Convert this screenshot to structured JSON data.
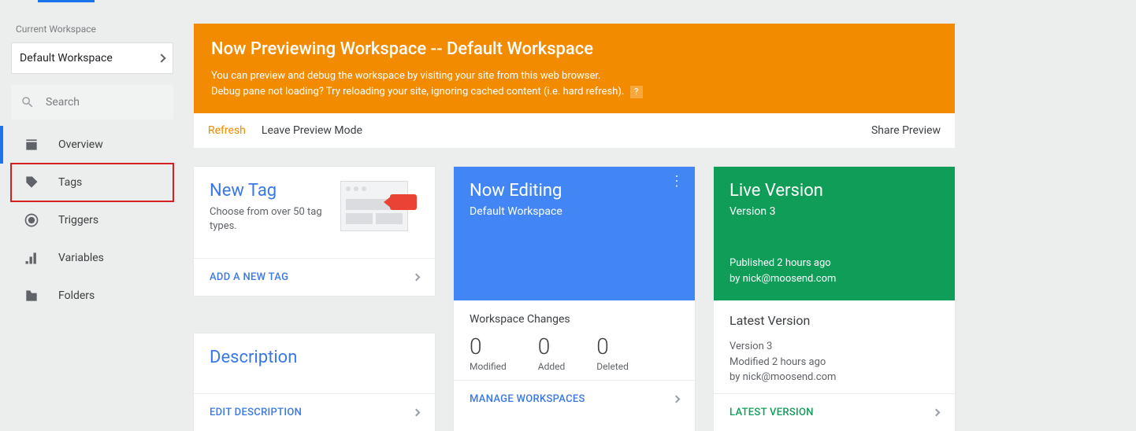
{
  "sidebar": {
    "current_workspace_label": "Current Workspace",
    "workspace_name": "Default Workspace",
    "search_placeholder": "Search",
    "items": [
      {
        "label": "Overview"
      },
      {
        "label": "Tags"
      },
      {
        "label": "Triggers"
      },
      {
        "label": "Variables"
      },
      {
        "label": "Folders"
      }
    ]
  },
  "preview": {
    "title": "Now Previewing Workspace -- Default Workspace",
    "line1": "You can preview and debug the workspace by visiting your site from this web browser.",
    "line2": "Debug pane not loading? Try reloading your site, ignoring cached content (i.e. hard refresh).",
    "refresh": "Refresh",
    "leave": "Leave Preview Mode",
    "share": "Share Preview",
    "help": "?"
  },
  "newtag": {
    "title": "New Tag",
    "subtitle": "Choose from over 50 tag types.",
    "action": "ADD A NEW TAG"
  },
  "description": {
    "title": "Description",
    "action": "EDIT DESCRIPTION"
  },
  "editing": {
    "title": "Now Editing",
    "workspace": "Default Workspace",
    "wc_title": "Workspace Changes",
    "stats": {
      "modified": {
        "num": "0",
        "label": "Modified"
      },
      "added": {
        "num": "0",
        "label": "Added"
      },
      "deleted": {
        "num": "0",
        "label": "Deleted"
      }
    },
    "action": "MANAGE WORKSPACES"
  },
  "live": {
    "title": "Live Version",
    "version": "Version 3",
    "published_line1": "Published 2 hours ago",
    "published_line2": "by nick@moosend.com",
    "latest_title": "Latest Version",
    "latest_version": "Version 3",
    "latest_mod": "Modified 2 hours ago",
    "latest_by": "by nick@moosend.com",
    "action": "LATEST VERSION"
  }
}
